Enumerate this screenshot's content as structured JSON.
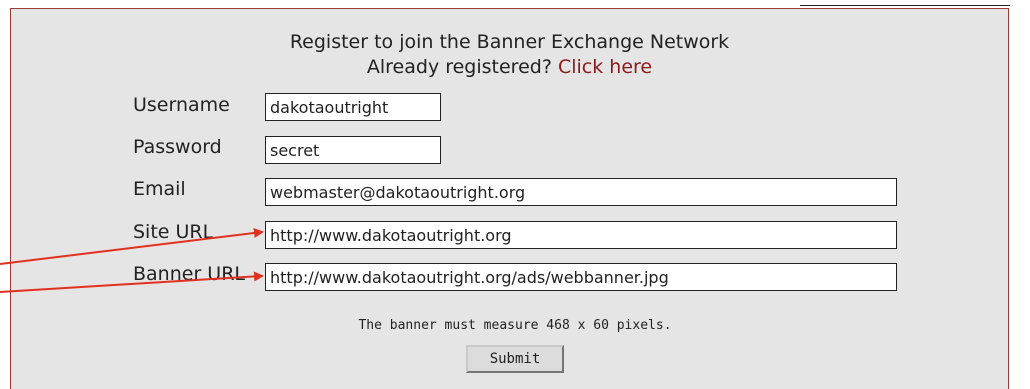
{
  "form": {
    "heading": "Register to join the Banner Exchange Network",
    "already_registered": "Already registered?",
    "click_here": "Click here",
    "fields": [
      {
        "label": "Username",
        "value": "dakotaoutright"
      },
      {
        "label": "Password",
        "value": "secret"
      },
      {
        "label": "Email",
        "value": "webmaster@dakotaoutright.org"
      },
      {
        "label": "Site URL",
        "value": "http://www.dakotaoutright.org"
      },
      {
        "label": "Banner URL",
        "value": "http://www.dakotaoutright.org/ads/webbanner.jpg"
      }
    ],
    "banner_note": "The banner must measure 468 x 60 pixels.",
    "submit_label": "Submit"
  },
  "colors": {
    "panel_bg": "#e5e5e5",
    "panel_border": "#a23a3a",
    "link": "#8b1a1a",
    "arrow": "#e0301e"
  }
}
